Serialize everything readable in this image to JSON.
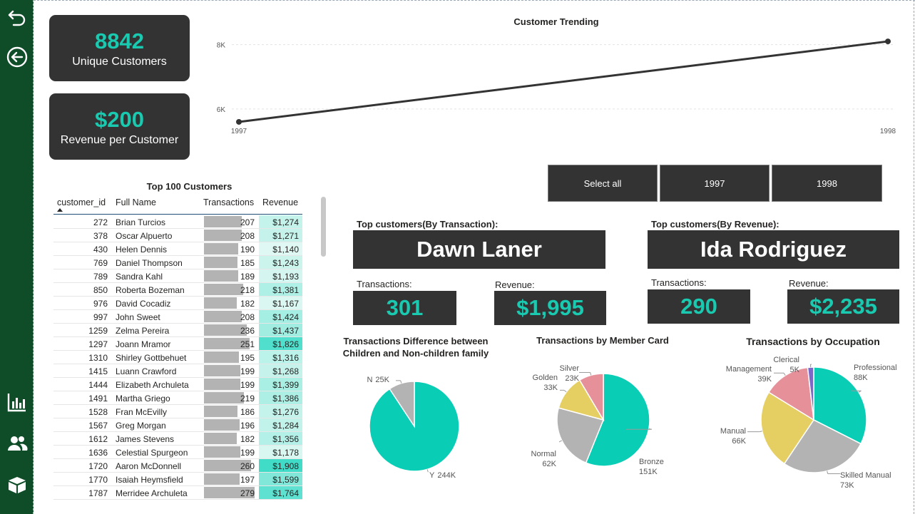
{
  "colors": {
    "sidebar": "#0f4d29",
    "card_bg": "#333333",
    "accent": "#19c9b0",
    "pie_teal": "#0acdb6",
    "pie_gray": "#b3b3b3",
    "pie_yellow": "#e6cf62",
    "pie_pink": "#e6909a",
    "pie_purple": "#7b68c8"
  },
  "sidebar": {
    "icons": [
      "undo-icon",
      "back-arrow-icon",
      "chart-icon",
      "people-icon",
      "box-icon"
    ]
  },
  "kpis": {
    "unique_customers": {
      "value": "8842",
      "label": "Unique Customers"
    },
    "revenue_per_customer": {
      "value": "$200",
      "label": "Revenue per Customer"
    }
  },
  "slicer": {
    "options": [
      "Select all",
      "1997",
      "1998"
    ]
  },
  "table": {
    "title": "Top 100 Customers",
    "columns": [
      "customer_id",
      "Full Name",
      "Transactions",
      "Revenue"
    ],
    "rows": [
      {
        "id": "272",
        "name": "Brian Turcios",
        "tx": "207",
        "rev": "$1,274"
      },
      {
        "id": "378",
        "name": "Oscar Alpuerto",
        "tx": "208",
        "rev": "$1,271"
      },
      {
        "id": "430",
        "name": "Helen Dennis",
        "tx": "190",
        "rev": "$1,140"
      },
      {
        "id": "769",
        "name": "Daniel Thompson",
        "tx": "185",
        "rev": "$1,243"
      },
      {
        "id": "789",
        "name": "Sandra Kahl",
        "tx": "189",
        "rev": "$1,193"
      },
      {
        "id": "850",
        "name": "Roberta Bozeman",
        "tx": "218",
        "rev": "$1,381"
      },
      {
        "id": "976",
        "name": "David Cocadiz",
        "tx": "182",
        "rev": "$1,167"
      },
      {
        "id": "997",
        "name": "John Sweet",
        "tx": "208",
        "rev": "$1,424"
      },
      {
        "id": "1259",
        "name": "Zelma Pereira",
        "tx": "236",
        "rev": "$1,437"
      },
      {
        "id": "1297",
        "name": "Joann Mramor",
        "tx": "251",
        "rev": "$1,826"
      },
      {
        "id": "1310",
        "name": "Shirley Gottbehuet",
        "tx": "195",
        "rev": "$1,316"
      },
      {
        "id": "1415",
        "name": "Luann Crawford",
        "tx": "199",
        "rev": "$1,268"
      },
      {
        "id": "1444",
        "name": "Elizabeth Archuleta",
        "tx": "199",
        "rev": "$1,399"
      },
      {
        "id": "1491",
        "name": "Martha Griego",
        "tx": "219",
        "rev": "$1,386"
      },
      {
        "id": "1528",
        "name": "Fran McEvilly",
        "tx": "186",
        "rev": "$1,276"
      },
      {
        "id": "1567",
        "name": "Greg Morgan",
        "tx": "196",
        "rev": "$1,284"
      },
      {
        "id": "1612",
        "name": "James Stevens",
        "tx": "182",
        "rev": "$1,356"
      },
      {
        "id": "1636",
        "name": "Celestial Spurgeon",
        "tx": "199",
        "rev": "$1,178"
      },
      {
        "id": "1720",
        "name": "Aaron McDonnell",
        "tx": "260",
        "rev": "$1,908"
      },
      {
        "id": "1770",
        "name": "Isaiah Heymsfield",
        "tx": "197",
        "rev": "$1,599"
      },
      {
        "id": "1787",
        "name": "Merridee Archuleta",
        "tx": "279",
        "rev": "$1,764"
      }
    ]
  },
  "top_transaction": {
    "heading": "Top customers(By Transaction):",
    "name": "Dawn Laner",
    "tx_label": "Transactions:",
    "tx_value": "301",
    "rev_label": "Revenue:",
    "rev_value": "$1,995"
  },
  "top_revenue": {
    "heading": "Top customers(By Revenue):",
    "name": "Ida Rodriguez",
    "tx_label": "Transactions:",
    "tx_value": "290",
    "rev_label": "Revenue:",
    "rev_value": "$2,235"
  },
  "chart_data": [
    {
      "type": "line",
      "title": "Customer Trending",
      "x": [
        "1997",
        "1998"
      ],
      "series": [
        {
          "values": [
            5600,
            8100
          ]
        }
      ],
      "y_ticks": [
        "6K",
        "8K"
      ],
      "ylim": [
        5400,
        8500
      ],
      "grid": true
    },
    {
      "type": "pie",
      "title": "Transactions Difference between Children and Non-children family",
      "labels": [
        "Y",
        "N"
      ],
      "values": [
        244,
        25
      ],
      "value_labels": [
        "244K",
        "25K"
      ],
      "colors": [
        "#0acdb6",
        "#b3b3b3"
      ]
    },
    {
      "type": "pie",
      "title": "Transactions by Member Card",
      "labels": [
        "Bronze",
        "Normal",
        "Golden",
        "Silver"
      ],
      "values": [
        151,
        62,
        33,
        23
      ],
      "value_labels": [
        "151K",
        "62K",
        "33K",
        "23K"
      ],
      "colors": [
        "#0acdb6",
        "#b3b3b3",
        "#e6cf62",
        "#e6909a"
      ]
    },
    {
      "type": "pie",
      "title": "Transactions by Occupation",
      "labels": [
        "Professional",
        "Skilled Manual",
        "Manual",
        "Management",
        "Clerical"
      ],
      "values": [
        88,
        73,
        66,
        39,
        5
      ],
      "value_labels": [
        "88K",
        "73K",
        "66K",
        "39K",
        "5K"
      ],
      "colors": [
        "#0acdb6",
        "#b3b3b3",
        "#e6cf62",
        "#e6909a",
        "#7b68c8"
      ]
    }
  ]
}
